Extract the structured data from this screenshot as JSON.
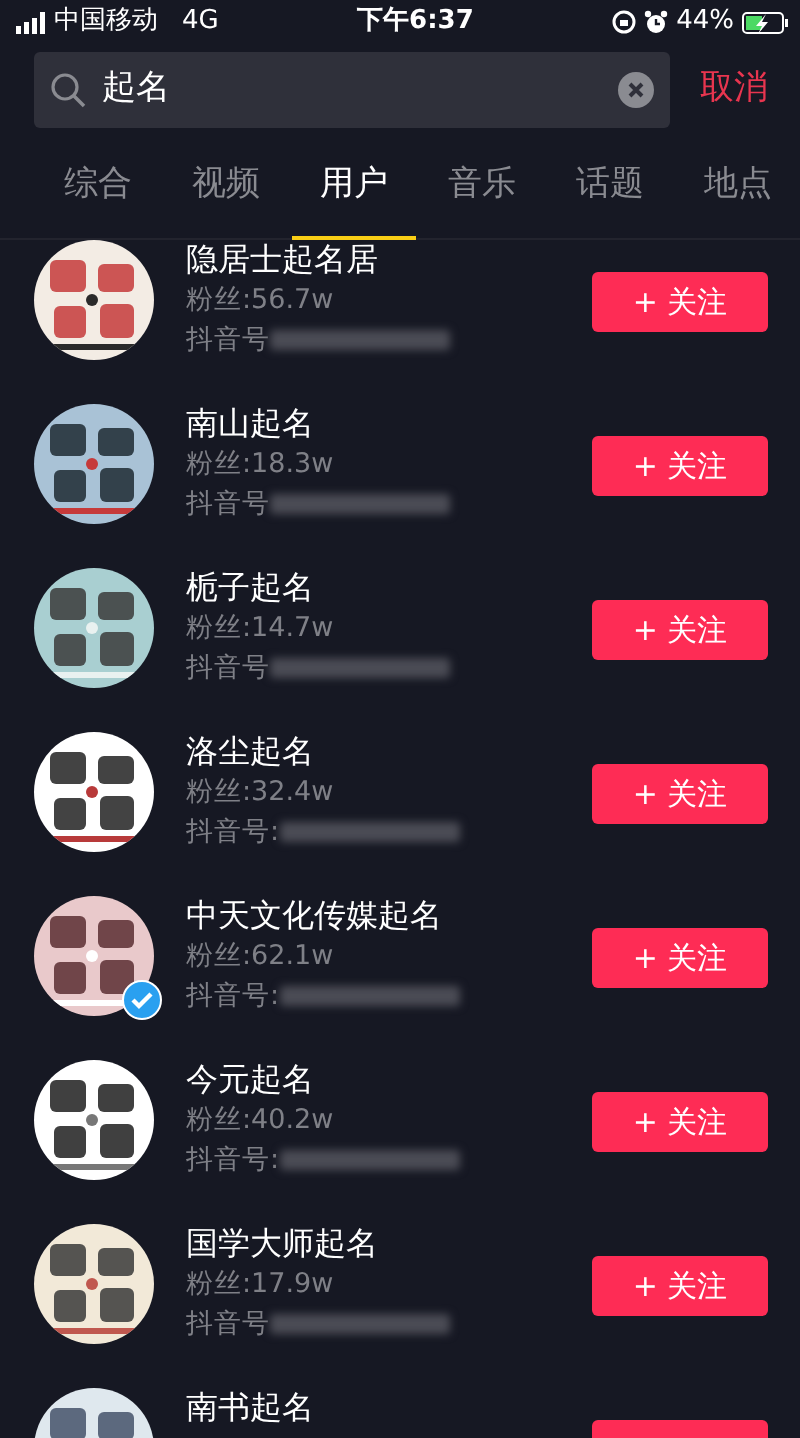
{
  "status_bar": {
    "carrier": "中国移动",
    "network": "4G",
    "time": "下午6:37",
    "battery": "44%",
    "charging": true
  },
  "search": {
    "value": "起名",
    "cancel": "取消"
  },
  "tabs": [
    {
      "label": "综合",
      "selected": false
    },
    {
      "label": "视频",
      "selected": false
    },
    {
      "label": "用户",
      "selected": true
    },
    {
      "label": "音乐",
      "selected": false
    },
    {
      "label": "话题",
      "selected": false
    },
    {
      "label": "地点",
      "selected": false
    }
  ],
  "users": [
    {
      "name": "隐居士起名居",
      "fans": "粉丝:56.7w",
      "id_label": "抖音号",
      "verified": false,
      "follow": "+ 关注"
    },
    {
      "name": "南山起名",
      "fans": "粉丝:18.3w",
      "id_label": "抖音号",
      "verified": false,
      "follow": "+ 关注"
    },
    {
      "name": "栀子起名",
      "fans": "粉丝:14.7w",
      "id_label": "抖音号",
      "verified": false,
      "follow": "+ 关注"
    },
    {
      "name": "洛尘起名",
      "fans": "粉丝:32.4w",
      "id_label": "抖音号:",
      "verified": false,
      "follow": "+ 关注"
    },
    {
      "name": "中天文化传媒起名",
      "fans": "粉丝:62.1w",
      "id_label": "抖音号:",
      "verified": true,
      "follow": "+ 关注"
    },
    {
      "name": "今元起名",
      "fans": "粉丝:40.2w",
      "id_label": "抖音号:",
      "verified": false,
      "follow": "+ 关注"
    },
    {
      "name": "国学大师起名",
      "fans": "粉丝:17.9w",
      "id_label": "抖音号",
      "verified": false,
      "follow": "+ 关注"
    },
    {
      "name": "南书起名",
      "verified": false
    }
  ]
}
